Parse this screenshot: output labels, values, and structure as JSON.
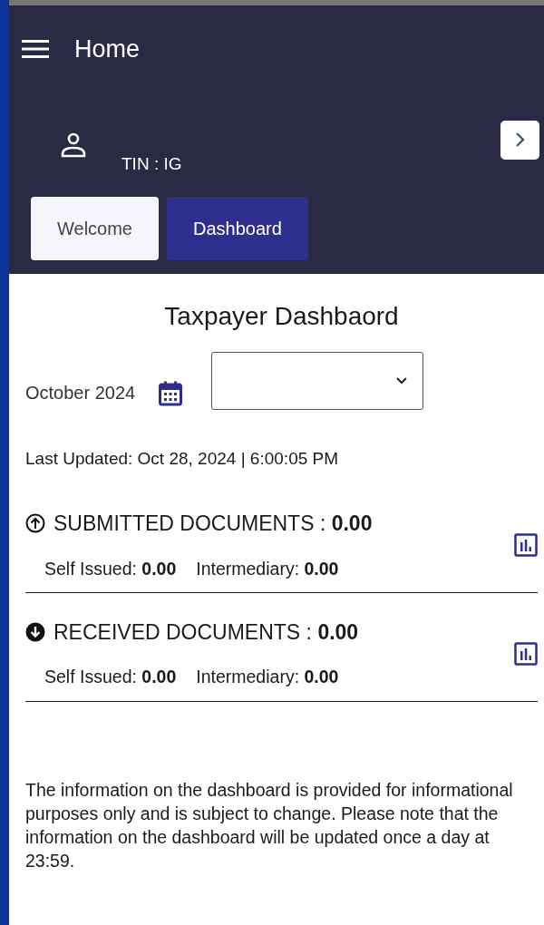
{
  "app_bar": {
    "title": "Home"
  },
  "profile": {
    "tin": "TIN : IG"
  },
  "tabs": [
    {
      "label": "Welcome",
      "selected": false
    },
    {
      "label": "Dashboard",
      "selected": true
    }
  ],
  "dashboard": {
    "title": "Taxpayer Dashbaord",
    "period": "October 2024",
    "last_updated": "Last Updated: Oct 28, 2024 | 6:00:05 PM"
  },
  "sections": [
    {
      "kind": "up",
      "heading": "SUBMITTED DOCUMENTS : **0.00**",
      "self_issued": "Self Issued: **0.00**",
      "intermediary": "Intermediary: **0.00**"
    },
    {
      "kind": "down",
      "heading": "RECEIVED DOCUMENTS  : **0.00**",
      "self_issued": "Self Issued: **0.00**",
      "intermediary": "Intermediary: **0.00**"
    }
  ],
  "disclaimer": "The information on the dashboard is provided for informational purposes only and is subject to change. Please note that the information on the dashboard will be updated once a day at 23:59."
}
